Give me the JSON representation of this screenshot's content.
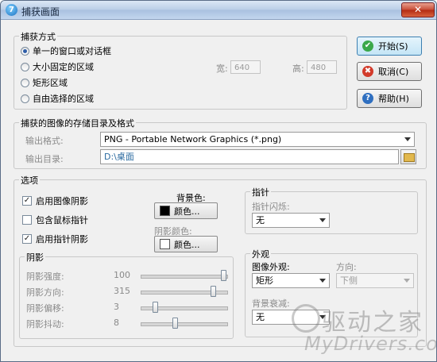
{
  "window": {
    "title": "捕获画面",
    "app_icon_glyph": "7",
    "close_glyph": "✕"
  },
  "capture_mode": {
    "title": "捕获方式",
    "options": [
      "单一的窗口或对话框",
      "大小固定的区域",
      "矩形区域",
      "自由选择的区域"
    ],
    "selected_index": 0,
    "width_label": "宽:",
    "width_value": "640",
    "height_label": "高:",
    "height_value": "480"
  },
  "buttons": {
    "start": "开始(S)",
    "cancel": "取消(C)",
    "help": "帮助(H)",
    "start_icon": "✔",
    "cancel_icon": "✖",
    "help_icon": "?"
  },
  "storage": {
    "title": "捕获的图像的存储目录及格式",
    "format_label": "输出格式:",
    "format_value": "PNG - Portable Network Graphics (*.png)",
    "dir_label": "输出目录:",
    "dir_value": "D:\\桌面"
  },
  "options": {
    "title": "选项",
    "enable_shadow": "启用图像阴影",
    "enable_shadow_checked": true,
    "include_pointer": "包含鼠标指针",
    "include_pointer_checked": false,
    "pointer_shadow": "启用指针阴影",
    "pointer_shadow_checked": true,
    "bg_color_label": "背景色:",
    "bg_color_button": "颜色...",
    "bg_color": "#000000",
    "shadow_color_label": "阴影颜色:",
    "shadow_color_button": "颜色...",
    "shadow_color": "#ffffff",
    "check_glyph": "✓"
  },
  "shadow": {
    "title": "阴影",
    "sliders": [
      {
        "label": "阴影强度:",
        "value": "100",
        "fraction": 1.0
      },
      {
        "label": "阴影方向:",
        "value": "315",
        "fraction": 0.875
      },
      {
        "label": "阴影偏移:",
        "value": "3",
        "fraction": 0.15
      },
      {
        "label": "阴影抖动:",
        "value": "8",
        "fraction": 0.4
      }
    ]
  },
  "pointer": {
    "title": "指针",
    "blink_label": "指针闪烁:",
    "blink_value": "无"
  },
  "appearance": {
    "title": "外观",
    "look_label": "图像外观:",
    "look_value": "矩形",
    "direction_label": "方向:",
    "direction_value": "下侧",
    "fade_label": "背景衰减:",
    "fade_value": "无"
  },
  "watermark": {
    "cn": "驱动之家",
    "en": "MyDrivers.com"
  },
  "colors": {
    "accent": "#2f5ea8",
    "disabled_text": "#8a8a8a"
  }
}
